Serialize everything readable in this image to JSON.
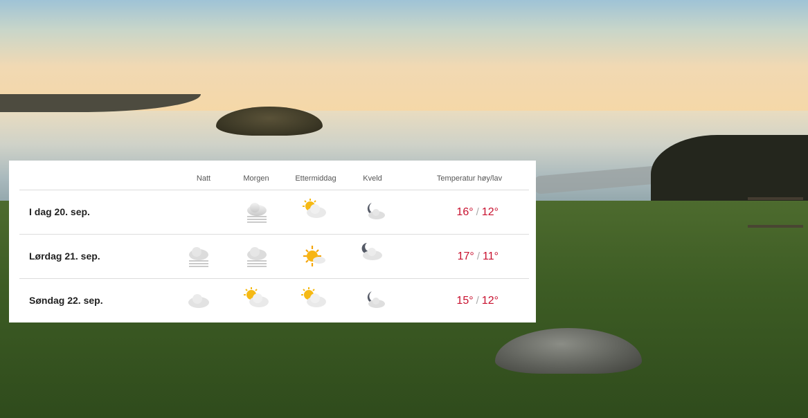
{
  "forecast": {
    "columns": [
      "Natt",
      "Morgen",
      "Ettermiddag",
      "Kveld",
      "Temperatur høy/lav"
    ],
    "rows": [
      {
        "date": "I dag 20. sep.",
        "icons": [
          "",
          "fog-cloud-icon",
          "partly-sunny-icon",
          "night-partly-cloudy-icon"
        ],
        "high": "16°",
        "low": "12°"
      },
      {
        "date": "Lørdag 21. sep.",
        "icons": [
          "fog-cloud-icon",
          "fog-cloud-icon",
          "sunny-partly-cloudy-icon",
          "night-partly-cloudy-icon"
        ],
        "high": "17°",
        "low": "11°"
      },
      {
        "date": "Søndag 22. sep.",
        "icons": [
          "cloud-icon",
          "partly-sunny-icon",
          "partly-sunny-icon",
          "night-partly-cloudy-icon"
        ],
        "high": "15°",
        "low": "12°"
      }
    ],
    "separator": "/"
  },
  "colors": {
    "temperature": "#c8102e",
    "separator": "#aaaaaa",
    "divider": "#dcdcdc"
  }
}
